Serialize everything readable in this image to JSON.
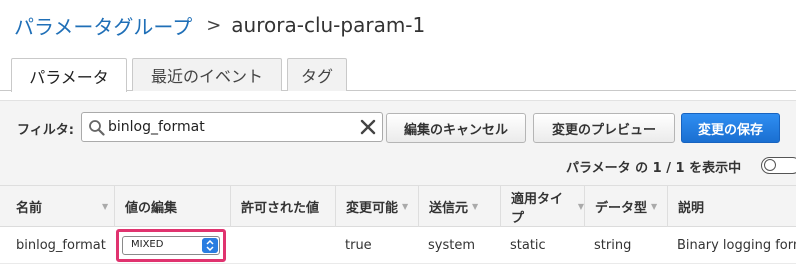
{
  "breadcrumb": {
    "parent": "パラメータグループ",
    "separator": ">",
    "current": "aurora-clu-param-1"
  },
  "tabs": [
    {
      "label": "パラメータ",
      "active": true
    },
    {
      "label": "最近のイベント",
      "active": false
    },
    {
      "label": "タグ",
      "active": false
    }
  ],
  "toolbar": {
    "filter_label": "フィルタ:",
    "filter_value": "binlog_format",
    "cancel_label": "編集のキャンセル",
    "preview_label": "変更のプレビュー",
    "save_label": "変更の保存",
    "count_text": "パラメータ の 1 / 1 を表示中"
  },
  "table": {
    "headers": [
      "名前",
      "値の編集",
      "許可された値",
      "変更可能",
      "送信元",
      "適用タイプ",
      "データ型",
      "説明"
    ],
    "rows": [
      {
        "name": "binlog_format",
        "edit_value": "MIXED",
        "allowed": "",
        "modifiable": "true",
        "source": "system",
        "apply_type": "static",
        "data_type": "string",
        "description": "Binary logging format"
      }
    ]
  },
  "colors": {
    "link": "#1f6fb7",
    "primary_button": "#1a6fd1",
    "highlight": "#e0336f",
    "select_arrow": "#2a7de1"
  },
  "icons": [
    "search-icon",
    "clear-icon",
    "sort-caret-icon",
    "select-arrow-icon",
    "toggle-switch"
  ]
}
